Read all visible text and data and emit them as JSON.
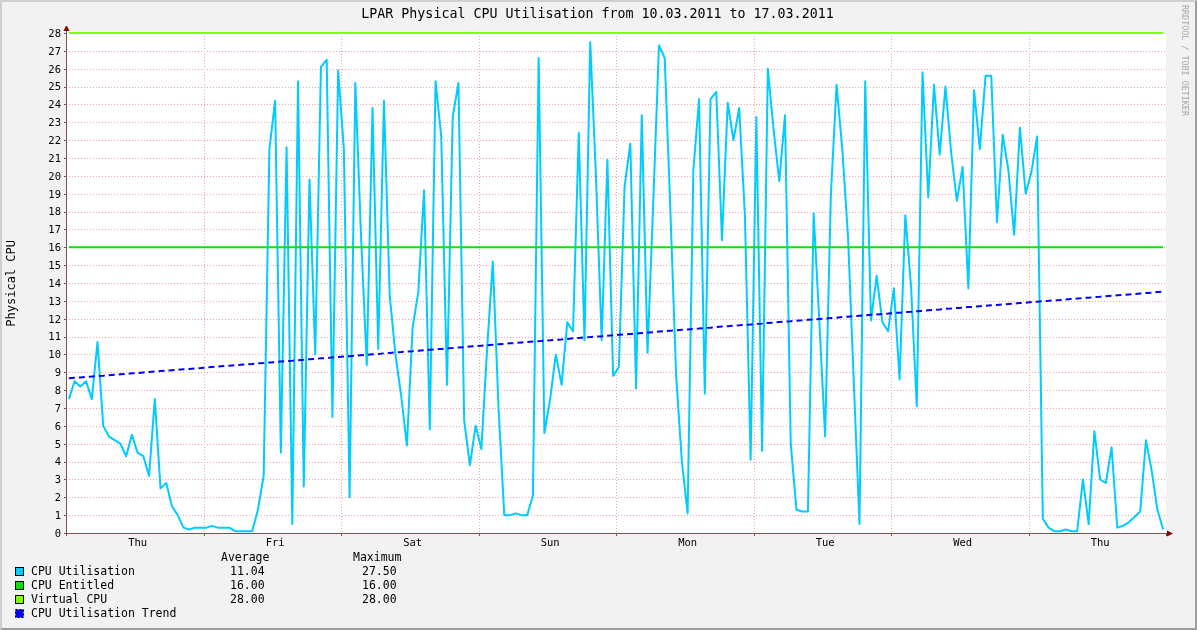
{
  "chart_data": {
    "type": "line",
    "title": "LPAR Physical CPU Utilisation from 10.03.2011 to 17.03.2011",
    "ylabel": "Physical CPU",
    "ylim": [
      0,
      28
    ],
    "grid": true,
    "yticks": [
      0,
      1,
      2,
      3,
      4,
      5,
      6,
      7,
      8,
      9,
      10,
      11,
      12,
      13,
      14,
      15,
      16,
      17,
      18,
      19,
      20,
      21,
      22,
      23,
      24,
      25,
      26,
      27,
      28
    ],
    "categories": [
      null,
      null,
      null,
      null,
      null,
      null,
      null,
      null,
      null,
      null,
      null,
      null,
      "Thu",
      null,
      null,
      null,
      null,
      null,
      null,
      null,
      null,
      null,
      null,
      null,
      null,
      null,
      null,
      null,
      null,
      null,
      null,
      null,
      null,
      null,
      null,
      null,
      "Fri",
      null,
      null,
      null,
      null,
      null,
      null,
      null,
      null,
      null,
      null,
      null,
      null,
      null,
      null,
      null,
      null,
      null,
      null,
      null,
      null,
      null,
      null,
      null,
      "Sat",
      null,
      null,
      null,
      null,
      null,
      null,
      null,
      null,
      null,
      null,
      null,
      null,
      null,
      null,
      null,
      null,
      null,
      null,
      null,
      null,
      null,
      null,
      null,
      "Sun",
      null,
      null,
      null,
      null,
      null,
      null,
      null,
      null,
      null,
      null,
      null,
      null,
      null,
      null,
      null,
      null,
      null,
      null,
      null,
      null,
      null,
      null,
      null,
      "Mon",
      null,
      null,
      null,
      null,
      null,
      null,
      null,
      null,
      null,
      null,
      null,
      null,
      null,
      null,
      null,
      null,
      null,
      null,
      null,
      null,
      null,
      null,
      null,
      "Tue",
      null,
      null,
      null,
      null,
      null,
      null,
      null,
      null,
      null,
      null,
      null,
      null,
      null,
      null,
      null,
      null,
      null,
      null,
      null,
      null,
      null,
      null,
      null,
      "Wed",
      null,
      null,
      null,
      null,
      null,
      null,
      null,
      null,
      null,
      null,
      null,
      null,
      null,
      null,
      null,
      null,
      null,
      null,
      null,
      null,
      null,
      null,
      null,
      "Thu",
      null,
      null,
      null,
      null,
      null,
      null,
      null,
      null,
      null,
      null,
      null
    ],
    "series": [
      {
        "name": "CPU Utilisation",
        "color": "#00ccff",
        "values": [
          7.5,
          8.5,
          8.2,
          8.5,
          7.5,
          10.7,
          6,
          5.4,
          5.2,
          5.0,
          4.3,
          5.5,
          4.5,
          4.3,
          3.2,
          7.5,
          2.5,
          2.8,
          1.5,
          1.0,
          0.3,
          0.2,
          0.3,
          0.3,
          0.3,
          0.4,
          0.3,
          0.3,
          0.3,
          0.1,
          0.1,
          0.1,
          0.1,
          1.3,
          3.2,
          21.5,
          24.2,
          4.5,
          21.6,
          0.5,
          25.3,
          2.6,
          19.8,
          10,
          26.1,
          26.5,
          6.5,
          25.9,
          21.5,
          2.0,
          25.2,
          16.6,
          9.4,
          23.8,
          10.3,
          24.2,
          13.3,
          10,
          7.7,
          4.9,
          11.5,
          13.5,
          19.2,
          5.8,
          25.3,
          22.2,
          8.3,
          23.3,
          25.2,
          6.3,
          3.8,
          6,
          4.7,
          10.3,
          15.2,
          7,
          1.0,
          1.0,
          1.1,
          1.0,
          1.0,
          2.1,
          26.6,
          5.6,
          7.5,
          10,
          8.3,
          11.8,
          11.3,
          22.4,
          10.8,
          27.5,
          20,
          10.8,
          20.9,
          8.8,
          9.3,
          19.4,
          21.8,
          8.1,
          23.4,
          10.1,
          18.5,
          27.3,
          26.6,
          18,
          8.8,
          4,
          1.1,
          20.3,
          24.3,
          7.8,
          24.3,
          24.7,
          16.4,
          24.1,
          22,
          23.8,
          17.8,
          4.1,
          23.3,
          4.6,
          26,
          22.6,
          19.7,
          23.4,
          5,
          1.3,
          1.2,
          1.2,
          17.9,
          11.8,
          5.4,
          18.9,
          25.1,
          21.5,
          16.6,
          8.5,
          0.5,
          25.3,
          11.9,
          14.4,
          11.8,
          11.3,
          13.7,
          8.6,
          17.8,
          13.8,
          7.1,
          25.8,
          18.8,
          25.1,
          21.2,
          25,
          21.3,
          18.6,
          20.5,
          13.7,
          24.8,
          21.5,
          25.6,
          25.6,
          17.4,
          22.3,
          20.3,
          16.7,
          22.7,
          19,
          20.2,
          22.2,
          0.8,
          0.3,
          0.1,
          0.1,
          0.2,
          0.1,
          0.1,
          3.0,
          0.5,
          5.7,
          3,
          2.8,
          4.8,
          0.3,
          0.4,
          0.6,
          0.9,
          1.2,
          5.2,
          3.5,
          1.3,
          0.2
        ]
      },
      {
        "name": "CPU Entitled",
        "color": "#00e600",
        "values": [
          16,
          16,
          16,
          16,
          16,
          16,
          16,
          16,
          16,
          16,
          16,
          16,
          16,
          16,
          16,
          16,
          16,
          16,
          16,
          16,
          16,
          16,
          16,
          16,
          16,
          16,
          16,
          16,
          16,
          16,
          16,
          16,
          16,
          16,
          16,
          16,
          16,
          16,
          16,
          16,
          16,
          16,
          16,
          16,
          16,
          16,
          16,
          16,
          16,
          16,
          16,
          16,
          16,
          16,
          16,
          16,
          16,
          16,
          16,
          16,
          16,
          16,
          16,
          16,
          16,
          16,
          16,
          16,
          16,
          16,
          16,
          16,
          16,
          16,
          16,
          16,
          16,
          16,
          16,
          16,
          16,
          16,
          16,
          16,
          16,
          16,
          16,
          16,
          16,
          16,
          16,
          16,
          16,
          16,
          16,
          16,
          16,
          16,
          16,
          16,
          16,
          16,
          16,
          16,
          16,
          16,
          16,
          16,
          16,
          16,
          16,
          16,
          16,
          16,
          16,
          16,
          16,
          16,
          16,
          16,
          16,
          16,
          16,
          16,
          16,
          16,
          16,
          16,
          16,
          16,
          16,
          16,
          16,
          16,
          16,
          16,
          16,
          16,
          16,
          16,
          16,
          16,
          16,
          16,
          16,
          16,
          16,
          16,
          16,
          16,
          16,
          16,
          16,
          16,
          16,
          16,
          16,
          16,
          16,
          16,
          16,
          16,
          16,
          16,
          16,
          16,
          16,
          16,
          16,
          16,
          16,
          16,
          16,
          16,
          16,
          16,
          16,
          16,
          16,
          16,
          16,
          16,
          16,
          16,
          16,
          16,
          16,
          16,
          16,
          16,
          16,
          16
        ]
      },
      {
        "name": "Virtual CPU",
        "color": "#80ff00",
        "values": [
          28,
          28,
          28,
          28,
          28,
          28,
          28,
          28,
          28,
          28,
          28,
          28,
          28,
          28,
          28,
          28,
          28,
          28,
          28,
          28,
          28,
          28,
          28,
          28,
          28,
          28,
          28,
          28,
          28,
          28,
          28,
          28,
          28,
          28,
          28,
          28,
          28,
          28,
          28,
          28,
          28,
          28,
          28,
          28,
          28,
          28,
          28,
          28,
          28,
          28,
          28,
          28,
          28,
          28,
          28,
          28,
          28,
          28,
          28,
          28,
          28,
          28,
          28,
          28,
          28,
          28,
          28,
          28,
          28,
          28,
          28,
          28,
          28,
          28,
          28,
          28,
          28,
          28,
          28,
          28,
          28,
          28,
          28,
          28,
          28,
          28,
          28,
          28,
          28,
          28,
          28,
          28,
          28,
          28,
          28,
          28,
          28,
          28,
          28,
          28,
          28,
          28,
          28,
          28,
          28,
          28,
          28,
          28,
          28,
          28,
          28,
          28,
          28,
          28,
          28,
          28,
          28,
          28,
          28,
          28,
          28,
          28,
          28,
          28,
          28,
          28,
          28,
          28,
          28,
          28,
          28,
          28,
          28,
          28,
          28,
          28,
          28,
          28,
          28,
          28,
          28,
          28,
          28,
          28,
          28,
          28,
          28,
          28,
          28,
          28,
          28,
          28,
          28,
          28,
          28,
          28,
          28,
          28,
          28,
          28,
          28,
          28,
          28,
          28,
          28,
          28,
          28,
          28,
          28,
          28,
          28,
          28,
          28,
          28,
          28,
          28,
          28,
          28,
          28,
          28,
          28,
          28,
          28,
          28,
          28,
          28,
          28,
          28,
          28,
          28,
          28,
          28
        ]
      },
      {
        "name": "CPU Utilisation Trend",
        "color": "#0000ff",
        "line_style": "dashed",
        "values": [
          8.66,
          8.69,
          8.71,
          8.74,
          8.76,
          8.79,
          8.81,
          8.84,
          8.86,
          8.89,
          8.91,
          8.94,
          8.96,
          8.99,
          9.02,
          9.04,
          9.07,
          9.09,
          9.12,
          9.14,
          9.17,
          9.19,
          9.22,
          9.24,
          9.27,
          9.3,
          9.32,
          9.35,
          9.37,
          9.4,
          9.42,
          9.45,
          9.47,
          9.5,
          9.52,
          9.55,
          9.57,
          9.6,
          9.63,
          9.65,
          9.68,
          9.7,
          9.73,
          9.75,
          9.78,
          9.8,
          9.83,
          9.85,
          9.88,
          9.9,
          9.93,
          9.96,
          9.98,
          10.01,
          10.03,
          10.06,
          10.08,
          10.11,
          10.13,
          10.16,
          10.18,
          10.21,
          10.23,
          10.26,
          10.29,
          10.31,
          10.34,
          10.36,
          10.39,
          10.41,
          10.44,
          10.46,
          10.49,
          10.51,
          10.54,
          10.57,
          10.59,
          10.62,
          10.64,
          10.67,
          10.69,
          10.72,
          10.74,
          10.77,
          10.79,
          10.82,
          10.84,
          10.87,
          10.9,
          10.92,
          10.95,
          10.97,
          11,
          11.02,
          11.05,
          11.07,
          11.1,
          11.12,
          11.15,
          11.17,
          11.2,
          11.23,
          11.25,
          11.28,
          11.3,
          11.33,
          11.35,
          11.38,
          11.4,
          11.43,
          11.45,
          11.48,
          11.5,
          11.53,
          11.56,
          11.58,
          11.61,
          11.63,
          11.66,
          11.68,
          11.71,
          11.73,
          11.76,
          11.78,
          11.81,
          11.84,
          11.86,
          11.89,
          11.91,
          11.94,
          11.96,
          11.99,
          12.01,
          12.04,
          12.06,
          12.09,
          12.11,
          12.14,
          12.17,
          12.19,
          12.22,
          12.24,
          12.27,
          12.29,
          12.32,
          12.34,
          12.37,
          12.39,
          12.42,
          12.44,
          12.47,
          12.5,
          12.52,
          12.55,
          12.57,
          12.6,
          12.62,
          12.65,
          12.67,
          12.7,
          12.72,
          12.75,
          12.77,
          12.8,
          12.83,
          12.85,
          12.88,
          12.9,
          12.93,
          12.95,
          12.98,
          13,
          13.03,
          13.05,
          13.08,
          13.11,
          13.13,
          13.16,
          13.18,
          13.21,
          13.23,
          13.26,
          13.28,
          13.31,
          13.33,
          13.36,
          13.38,
          13.41,
          13.44,
          13.46,
          13.49,
          13.51
        ]
      }
    ]
  },
  "legend": {
    "headers": [
      "Average",
      "Maximum"
    ],
    "rows": [
      {
        "average": "11.04",
        "maximum": "27.50"
      },
      {
        "average": "16.00",
        "maximum": "16.00"
      },
      {
        "average": "28.00",
        "maximum": "28.00"
      }
    ]
  },
  "credit": "RRDTOOL / TOBI OETIKER"
}
